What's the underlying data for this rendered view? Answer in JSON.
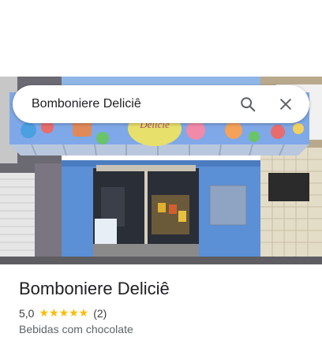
{
  "search": {
    "query": "Bomboniere Deliciê",
    "search_icon": "search-icon",
    "close_icon": "close-icon"
  },
  "photo": {
    "sign_text": "Deliciê"
  },
  "place": {
    "name": "Bomboniere Deliciê",
    "rating": "5,0",
    "stars": "★★★★★",
    "review_count": "(2)",
    "category": "Bebidas com chocolate"
  },
  "colors": {
    "star": "#fbbc04",
    "wall_blue": "#5b8fd6",
    "tile": "#d8cfb8"
  }
}
